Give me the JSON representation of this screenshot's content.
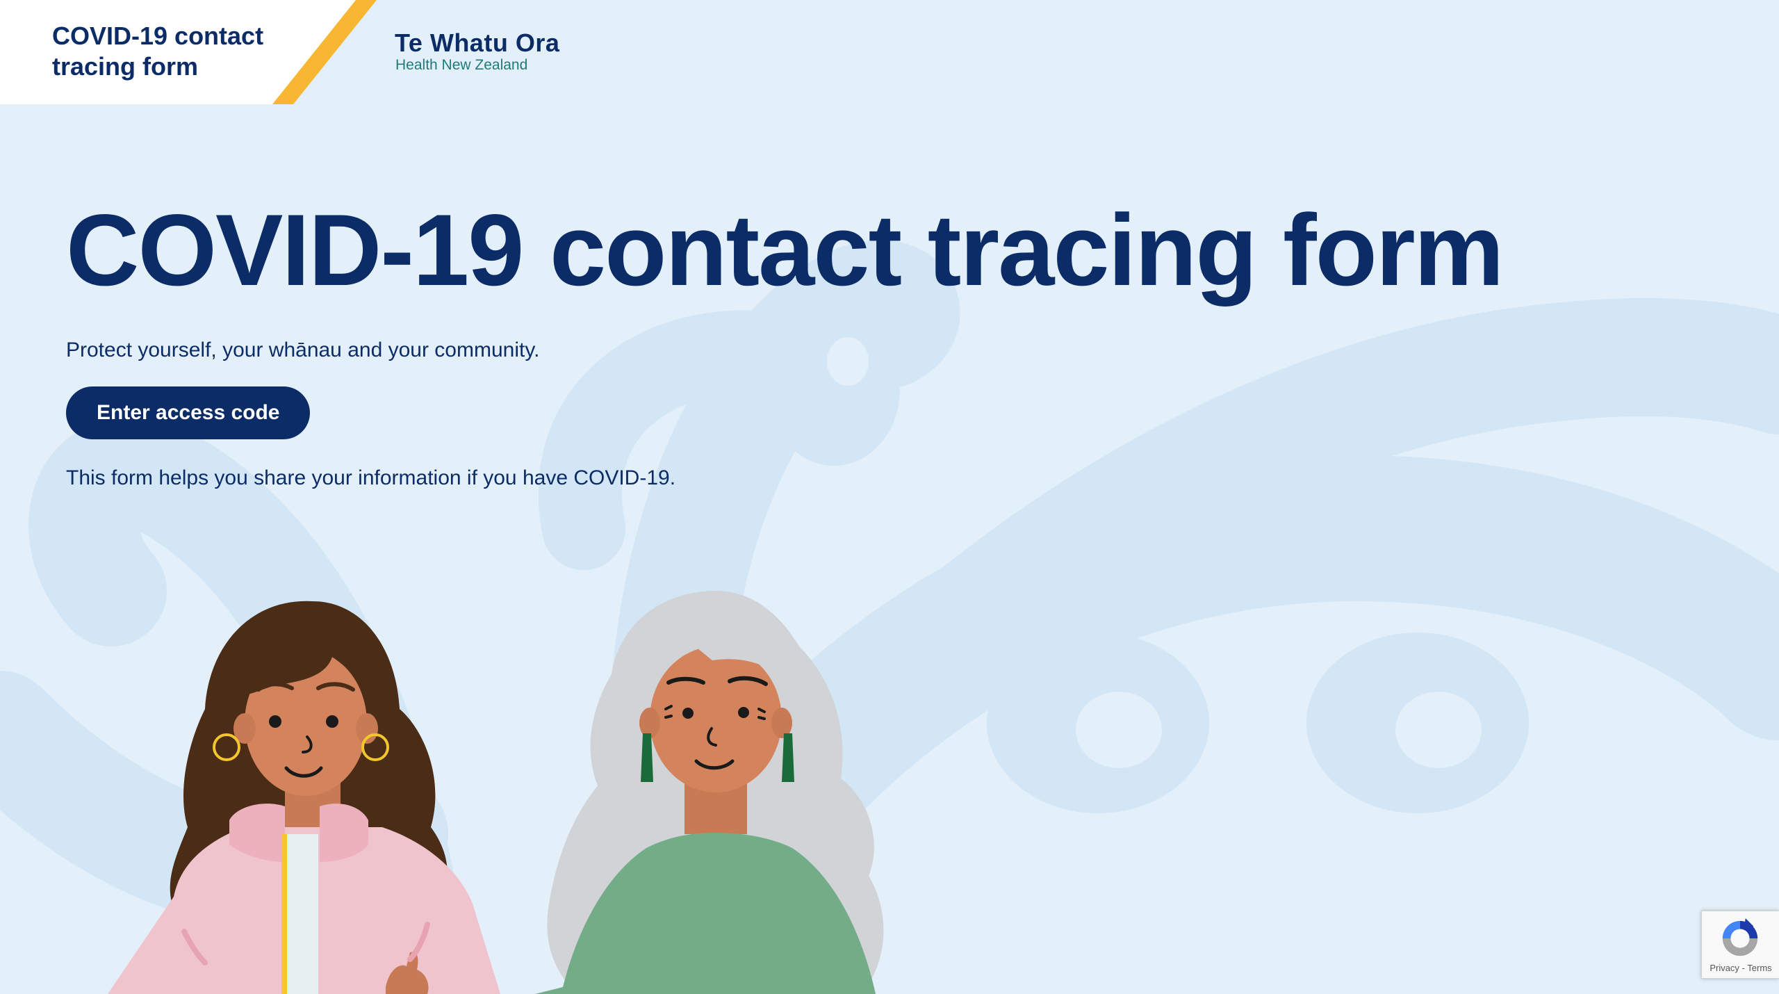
{
  "header": {
    "title": "COVID-19 contact tracing form",
    "brand_name": "Te Whatu Ora",
    "brand_sub": "Health New Zealand"
  },
  "main": {
    "title": "COVID-19 contact tracing form",
    "tagline": "Protect yourself, your whānau and your community.",
    "cta_label": "Enter access code",
    "info": "This form helps you share your information if you have COVID-19."
  },
  "recaptcha": {
    "privacy": "Privacy",
    "separator": "-",
    "terms": "Terms"
  },
  "colors": {
    "navy": "#0b2c66",
    "background": "#e3eff9",
    "accent_yellow": "#f7b733",
    "brand_teal": "#1f7a7a"
  },
  "icons": [
    "recaptcha-icon"
  ]
}
